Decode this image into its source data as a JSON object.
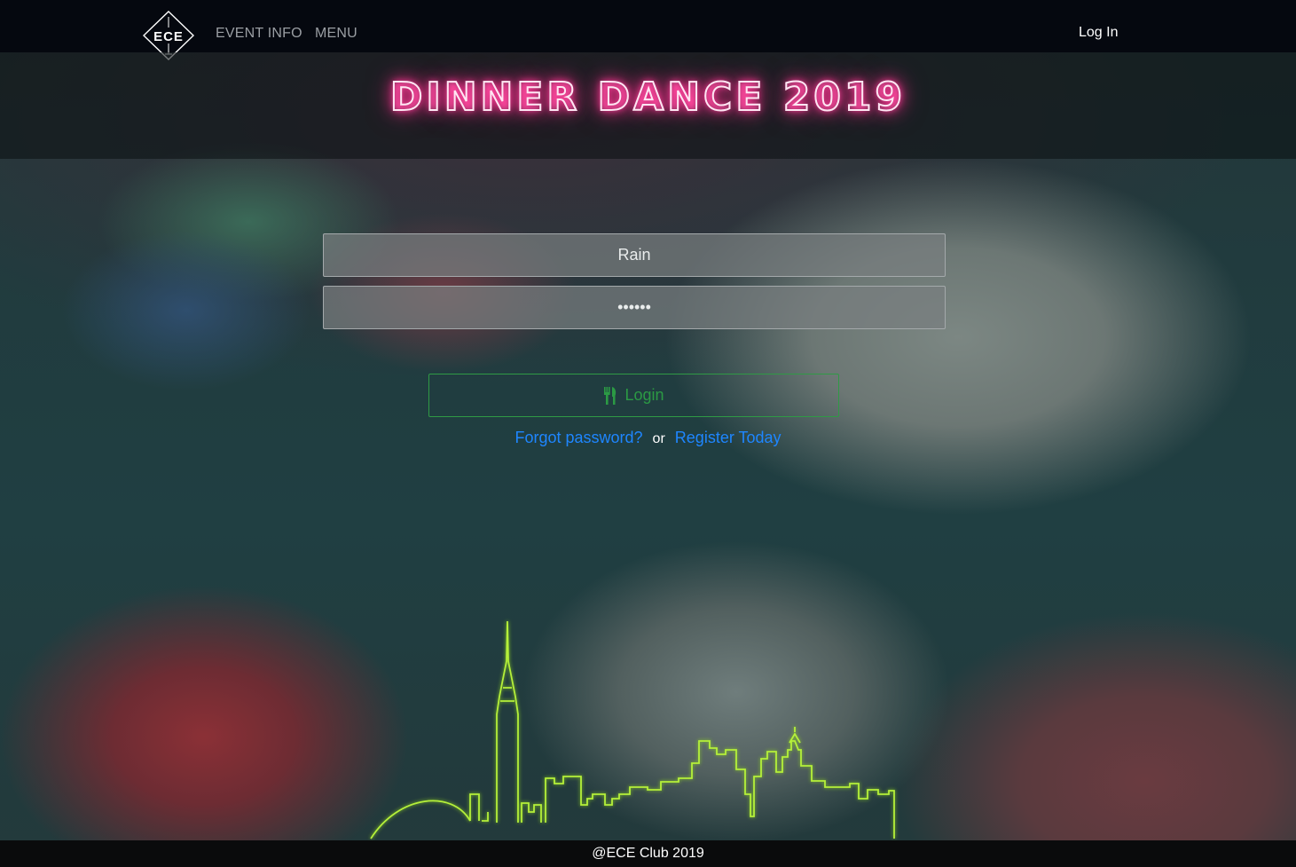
{
  "nav": {
    "logo_text": "ECE",
    "event_info": "EVENT INFO",
    "menu": "MENU",
    "login": "Log In"
  },
  "header": {
    "title": "DINNER DANCE 2019"
  },
  "form": {
    "username_value": "Rain",
    "password_value": "••••••",
    "login_button": "Login",
    "forgot_password": "Forgot password?",
    "or_text": "or",
    "register": "Register Today"
  },
  "footer": {
    "text": "@ECE Club 2019"
  },
  "colors": {
    "accent_pink": "#ff2f8c",
    "login_green": "#2b9a44",
    "link_blue": "#1e86ff",
    "skyline_green": "#b5f03a"
  },
  "icons": [
    "ece-logo-icon",
    "utensils-icon",
    "toronto-skyline-icon"
  ]
}
